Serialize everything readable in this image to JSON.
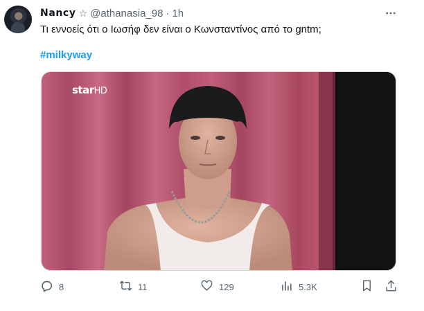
{
  "tweet": {
    "author_name": "Nancy",
    "badge_symbol": "☆",
    "handle": "@athanasia_98",
    "separator": "·",
    "time": "1h",
    "text": "Τι εννοείς ότι ο Ιωσήφ δεν είναι ο Κωνσταντίνος από το gntm;",
    "hashtag": "#milkyway",
    "more_icon": "more-horizontal-icon"
  },
  "media": {
    "watermark_star": "star",
    "watermark_hd": "HD",
    "description_colors": {
      "curtain": "#b8566f",
      "background_dark": "#101010"
    }
  },
  "actions": {
    "reply": {
      "icon": "reply-icon",
      "count": "8"
    },
    "retweet": {
      "icon": "retweet-icon",
      "count": "11"
    },
    "like": {
      "icon": "heart-icon",
      "count": "129"
    },
    "views": {
      "icon": "views-icon",
      "count": "5.3K"
    },
    "bookmark": {
      "icon": "bookmark-icon"
    },
    "share": {
      "icon": "share-icon"
    }
  },
  "colors": {
    "secondary_text": "#536471",
    "link": "#1d9bf0",
    "border": "#cfd9de"
  }
}
